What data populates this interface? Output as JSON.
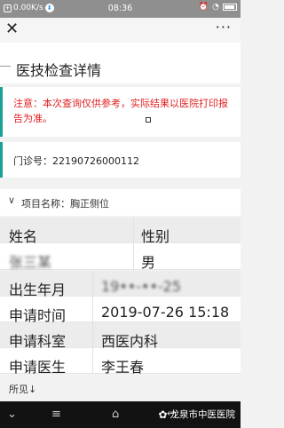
{
  "status": {
    "speed": "0.00K/s",
    "time": "08:36",
    "chat_badge": "O",
    "speed_badge": "⬇"
  },
  "nav": {
    "close": "✕",
    "more": "···"
  },
  "title": "医技检查详情",
  "notice": "注意：本次查询仅供参考，实际结果以医院打印报告为准。",
  "clinic_label": "门诊号：22190726000112",
  "project_label": "项目名称：胸正侧位",
  "table": {
    "header_left": "姓名",
    "header_right": "性别",
    "name_value": "张三某",
    "gender_value": "男",
    "rows": [
      {
        "label": "出生年月",
        "value": "19••-••-25"
      },
      {
        "label": "申请时间",
        "value": "2019-07-26 15:18"
      },
      {
        "label": "申请科室",
        "value": "西医内科"
      },
      {
        "label": "申请医生",
        "value": "李王春"
      }
    ]
  },
  "footer": "所见↓",
  "bottom": {
    "brand": "龙泉市中医医院"
  }
}
